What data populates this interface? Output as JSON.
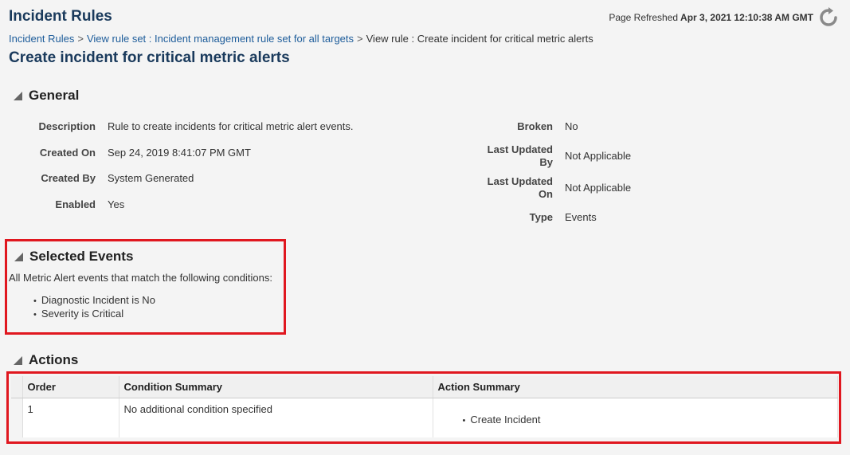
{
  "header": {
    "app_title": "Incident Rules",
    "refresh_label": "Page Refreshed",
    "refresh_time": "Apr 3, 2021 12:10:38 AM GMT"
  },
  "breadcrumb": {
    "items": [
      "Incident Rules",
      "View rule set : Incident management rule set for all targets",
      "View rule : Create incident for critical metric alerts"
    ],
    "separator": ">"
  },
  "page_title": "Create incident for critical metric alerts",
  "general": {
    "title": "General",
    "left_fields": [
      {
        "label": "Description",
        "value": "Rule to create incidents for critical metric alert events."
      },
      {
        "label": "Created On",
        "value": "Sep 24, 2019 8:41:07 PM GMT"
      },
      {
        "label": "Created By",
        "value": "System Generated"
      },
      {
        "label": "Enabled",
        "value": "Yes"
      }
    ],
    "right_fields": [
      {
        "label": "Broken",
        "value": "No"
      },
      {
        "label_line1": "Last Updated",
        "label_line2": "By",
        "value": "Not Applicable"
      },
      {
        "label_line1": "Last Updated",
        "label_line2": "On",
        "value": "Not Applicable"
      },
      {
        "label": "Type",
        "value": "Events"
      }
    ]
  },
  "selected_events": {
    "title": "Selected Events",
    "description": "All Metric Alert events that match the following conditions:",
    "conditions": [
      "Diagnostic Incident is No",
      "Severity is Critical"
    ]
  },
  "actions": {
    "title": "Actions",
    "columns": [
      "Order",
      "Condition Summary",
      "Action Summary"
    ],
    "rows": [
      {
        "order": "1",
        "condition": "No additional condition specified",
        "action": "Create Incident"
      }
    ]
  },
  "colors": {
    "title": "#1a3a5c",
    "link": "#1d5c9a",
    "highlight": "#e0171f"
  }
}
